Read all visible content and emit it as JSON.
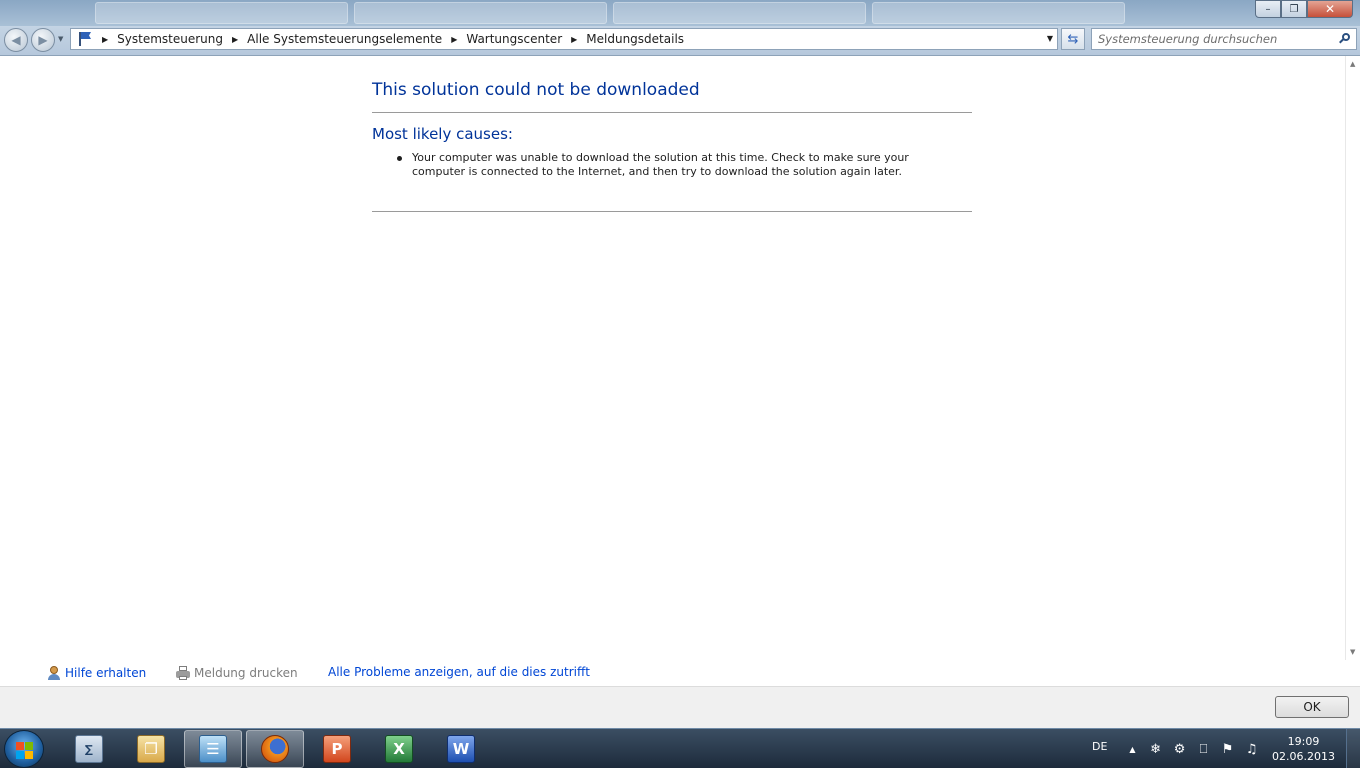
{
  "window": {
    "minimize": "–",
    "restore": "❐",
    "close": "✕"
  },
  "nav": {
    "back_glyph": "◀",
    "forward_glyph": "▶",
    "dropdown_glyph": "▼",
    "separator": "▶",
    "breadcrumbs": [
      "Systemsteuerung",
      "Alle Systemsteuerungselemente",
      "Wartungscenter",
      "Meldungsdetails"
    ],
    "refresh_glyph": "⇆"
  },
  "search": {
    "placeholder": "Systemsteuerung durchsuchen"
  },
  "main": {
    "title": "This solution could not be downloaded",
    "causes_heading": "Most likely causes:",
    "causes": [
      "Your computer was unable to download the solution at this time. Check to make sure your computer is connected to the Internet, and then try to download the solution again later."
    ]
  },
  "links": {
    "help": "Hilfe erhalten",
    "print": "Meldung drucken",
    "all_problems": "Alle Probleme anzeigen, auf die dies zutrifft"
  },
  "footer": {
    "ok": "OK"
  },
  "taskbar": {
    "apps": [
      {
        "name": "calculator",
        "glyph": "∑"
      },
      {
        "name": "explorer",
        "glyph": "❐"
      },
      {
        "name": "control-panel",
        "glyph": "☰"
      },
      {
        "name": "firefox",
        "glyph": ""
      },
      {
        "name": "powerpoint",
        "glyph": "P"
      },
      {
        "name": "excel",
        "glyph": "X"
      },
      {
        "name": "word",
        "glyph": "W"
      }
    ],
    "language": "DE",
    "tray_arrow": "▲",
    "tray_icons": [
      "❄",
      "⚙",
      "⎕",
      "⚑",
      "♫"
    ],
    "time": "19:09",
    "date": "02.06.2013"
  },
  "colors": {
    "heading": "#003399",
    "link": "#0046d5"
  }
}
